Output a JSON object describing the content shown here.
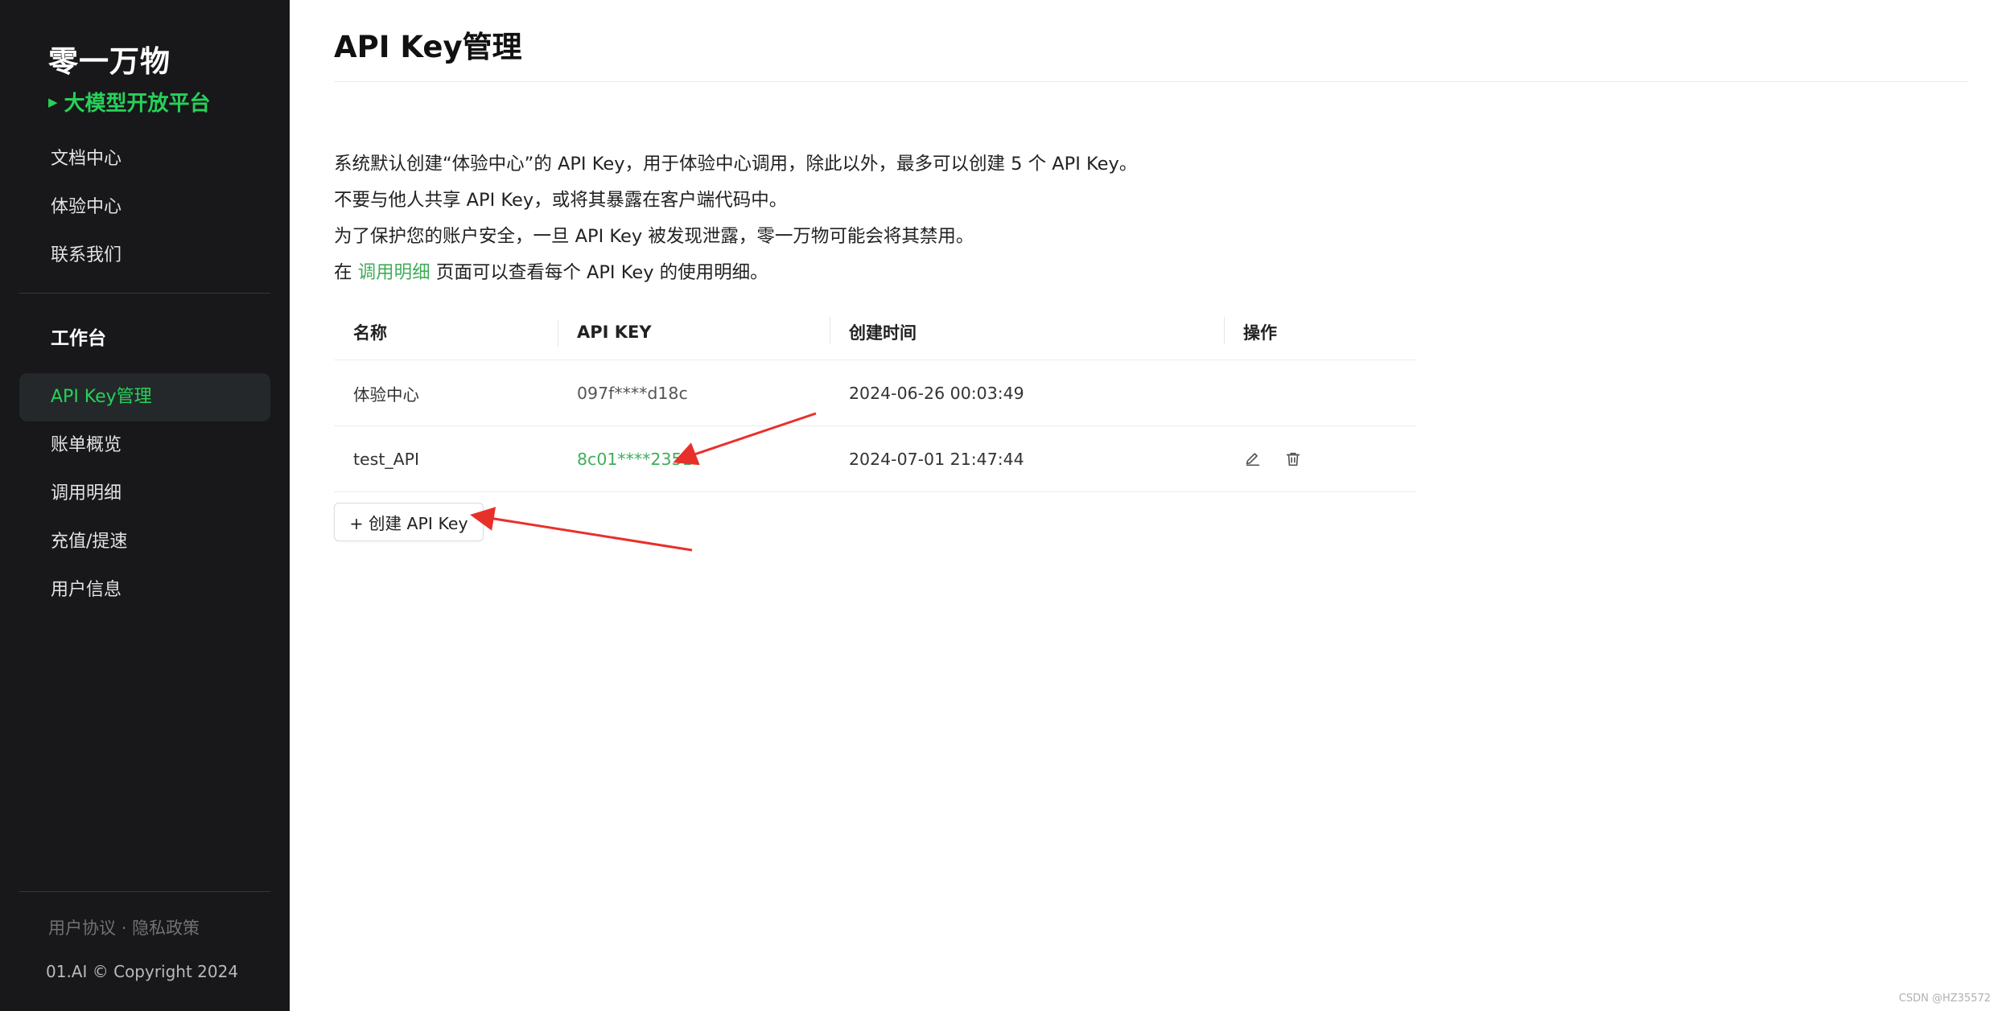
{
  "sidebar": {
    "brand_title": "零一万物",
    "brand_subtitle": "大模型开放平台",
    "nav_top": [
      {
        "label": "文档中心"
      },
      {
        "label": "体验中心"
      },
      {
        "label": "联系我们"
      }
    ],
    "section_title": "工作台",
    "nav_work": [
      {
        "label": "API Key管理"
      },
      {
        "label": "账单概览"
      },
      {
        "label": "调用明细"
      },
      {
        "label": "充值/提速"
      },
      {
        "label": "用户信息"
      }
    ],
    "active_item": "API Key管理",
    "footer_user_agreement": "用户协议",
    "footer_separator": "·",
    "footer_privacy": "隐私政策",
    "copyright": "01.AI © Copyright 2024"
  },
  "main": {
    "title": "API Key管理",
    "info_line1": "系统默认创建“体验中心”的 API Key，用于体验中心调用，除此以外，最多可以创建 5 个 API Key。",
    "info_line2": "不要与他人共享 API Key，或将其暴露在客户端代码中。",
    "info_line3": "为了保护您的账户安全，一旦 API Key 被发现泄露，零一万物可能会将其禁用。",
    "info_line4_prefix": "在 ",
    "info_line4_link": "调用明细",
    "info_line4_suffix": " 页面可以查看每个 API Key 的使用明细。",
    "table": {
      "headers": [
        "名称",
        "API KEY",
        "创建时间",
        "操作"
      ],
      "rows": [
        {
          "name": "体验中心",
          "key": "097f****d18c",
          "created": "2024-06-26 00:03:49"
        },
        {
          "name": "test_API",
          "key": "8c01****2351",
          "created": "2024-07-01 21:47:44"
        }
      ]
    },
    "create_button": "+ 创建 API Key"
  },
  "colors": {
    "sidebar_bg": "#18181a",
    "accent_green": "#26d15a",
    "link_green": "#3fae5a",
    "annotation_red": "#e8302a"
  },
  "icons": [
    "edit-icon",
    "delete-icon",
    "play-triangle-icon"
  ],
  "watermark": "CSDN @HZ35572"
}
